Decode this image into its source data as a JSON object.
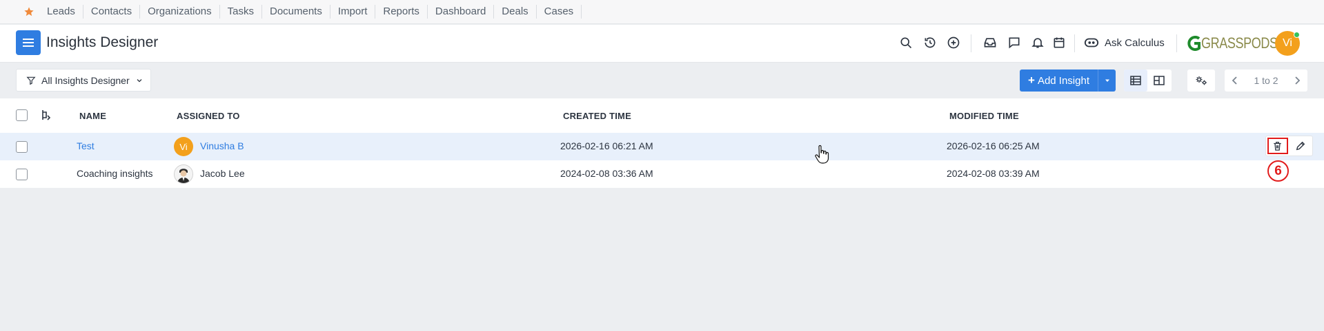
{
  "topnav": {
    "favorite_icon": "star-icon",
    "items": [
      "Leads",
      "Contacts",
      "Organizations",
      "Tasks",
      "Documents",
      "Import",
      "Reports",
      "Dashboard",
      "Deals",
      "Cases"
    ]
  },
  "header": {
    "menu_icon": "hamburger-icon",
    "title": "Insights Designer",
    "actions": [
      "search-icon",
      "history-icon",
      "add-circle-icon",
      "inbox-icon",
      "chat-icon",
      "bell-icon",
      "calendar-icon"
    ],
    "ask_label": "Ask Calculus",
    "logo_text": "GRASSPODS",
    "user_initials": "Vi",
    "online_color": "#35c15b"
  },
  "toolbar": {
    "filter_label": "All Insights Designer",
    "add_label": "Add Insight",
    "pager_text": "1 to 2",
    "accent": "#2f7de1"
  },
  "table": {
    "columns": [
      "NAME",
      "ASSIGNED TO",
      "CREATED TIME",
      "MODIFIED TIME"
    ],
    "rows": [
      {
        "name": "Test",
        "assigned_initials": "Vi",
        "assigned": "Vinusha B",
        "created": "2026-02-16 06:21 AM",
        "modified": "2026-02-16 06:25 AM"
      },
      {
        "name": "Coaching insights",
        "assigned": "Jacob Lee",
        "created": "2024-02-08 03:36 AM",
        "modified": "2024-02-08 03:39 AM"
      }
    ]
  },
  "annotation": {
    "number": "6",
    "color": "#e21b1b"
  }
}
